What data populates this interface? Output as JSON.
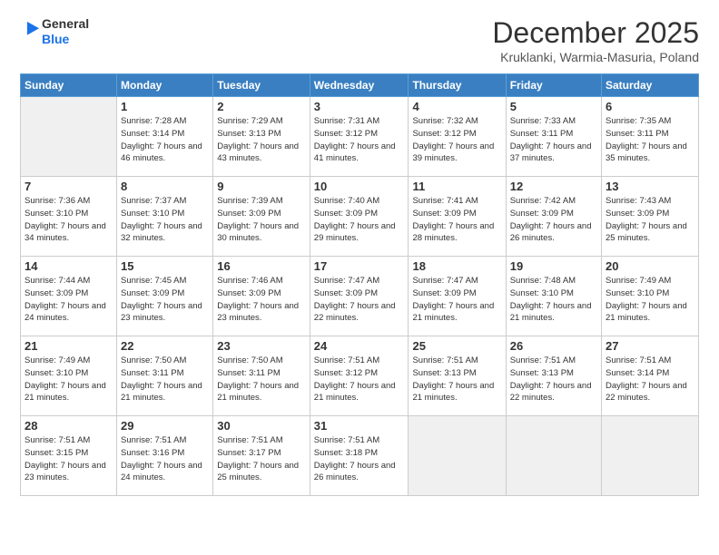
{
  "logo": {
    "line1": "General",
    "line2": "Blue"
  },
  "header": {
    "month": "December 2025",
    "location": "Kruklanki, Warmia-Masuria, Poland"
  },
  "weekdays": [
    "Sunday",
    "Monday",
    "Tuesday",
    "Wednesday",
    "Thursday",
    "Friday",
    "Saturday"
  ],
  "weeks": [
    [
      {
        "day": "",
        "empty": true
      },
      {
        "day": "1",
        "sunrise": "7:28 AM",
        "sunset": "3:14 PM",
        "daylight": "7 hours and 46 minutes."
      },
      {
        "day": "2",
        "sunrise": "7:29 AM",
        "sunset": "3:13 PM",
        "daylight": "7 hours and 43 minutes."
      },
      {
        "day": "3",
        "sunrise": "7:31 AM",
        "sunset": "3:12 PM",
        "daylight": "7 hours and 41 minutes."
      },
      {
        "day": "4",
        "sunrise": "7:32 AM",
        "sunset": "3:12 PM",
        "daylight": "7 hours and 39 minutes."
      },
      {
        "day": "5",
        "sunrise": "7:33 AM",
        "sunset": "3:11 PM",
        "daylight": "7 hours and 37 minutes."
      },
      {
        "day": "6",
        "sunrise": "7:35 AM",
        "sunset": "3:11 PM",
        "daylight": "7 hours and 35 minutes."
      }
    ],
    [
      {
        "day": "7",
        "sunrise": "7:36 AM",
        "sunset": "3:10 PM",
        "daylight": "7 hours and 34 minutes."
      },
      {
        "day": "8",
        "sunrise": "7:37 AM",
        "sunset": "3:10 PM",
        "daylight": "7 hours and 32 minutes."
      },
      {
        "day": "9",
        "sunrise": "7:39 AM",
        "sunset": "3:09 PM",
        "daylight": "7 hours and 30 minutes."
      },
      {
        "day": "10",
        "sunrise": "7:40 AM",
        "sunset": "3:09 PM",
        "daylight": "7 hours and 29 minutes."
      },
      {
        "day": "11",
        "sunrise": "7:41 AM",
        "sunset": "3:09 PM",
        "daylight": "7 hours and 28 minutes."
      },
      {
        "day": "12",
        "sunrise": "7:42 AM",
        "sunset": "3:09 PM",
        "daylight": "7 hours and 26 minutes."
      },
      {
        "day": "13",
        "sunrise": "7:43 AM",
        "sunset": "3:09 PM",
        "daylight": "7 hours and 25 minutes."
      }
    ],
    [
      {
        "day": "14",
        "sunrise": "7:44 AM",
        "sunset": "3:09 PM",
        "daylight": "7 hours and 24 minutes."
      },
      {
        "day": "15",
        "sunrise": "7:45 AM",
        "sunset": "3:09 PM",
        "daylight": "7 hours and 23 minutes."
      },
      {
        "day": "16",
        "sunrise": "7:46 AM",
        "sunset": "3:09 PM",
        "daylight": "7 hours and 23 minutes."
      },
      {
        "day": "17",
        "sunrise": "7:47 AM",
        "sunset": "3:09 PM",
        "daylight": "7 hours and 22 minutes."
      },
      {
        "day": "18",
        "sunrise": "7:47 AM",
        "sunset": "3:09 PM",
        "daylight": "7 hours and 21 minutes."
      },
      {
        "day": "19",
        "sunrise": "7:48 AM",
        "sunset": "3:10 PM",
        "daylight": "7 hours and 21 minutes."
      },
      {
        "day": "20",
        "sunrise": "7:49 AM",
        "sunset": "3:10 PM",
        "daylight": "7 hours and 21 minutes."
      }
    ],
    [
      {
        "day": "21",
        "sunrise": "7:49 AM",
        "sunset": "3:10 PM",
        "daylight": "7 hours and 21 minutes."
      },
      {
        "day": "22",
        "sunrise": "7:50 AM",
        "sunset": "3:11 PM",
        "daylight": "7 hours and 21 minutes."
      },
      {
        "day": "23",
        "sunrise": "7:50 AM",
        "sunset": "3:11 PM",
        "daylight": "7 hours and 21 minutes."
      },
      {
        "day": "24",
        "sunrise": "7:51 AM",
        "sunset": "3:12 PM",
        "daylight": "7 hours and 21 minutes."
      },
      {
        "day": "25",
        "sunrise": "7:51 AM",
        "sunset": "3:13 PM",
        "daylight": "7 hours and 21 minutes."
      },
      {
        "day": "26",
        "sunrise": "7:51 AM",
        "sunset": "3:13 PM",
        "daylight": "7 hours and 22 minutes."
      },
      {
        "day": "27",
        "sunrise": "7:51 AM",
        "sunset": "3:14 PM",
        "daylight": "7 hours and 22 minutes."
      }
    ],
    [
      {
        "day": "28",
        "sunrise": "7:51 AM",
        "sunset": "3:15 PM",
        "daylight": "7 hours and 23 minutes."
      },
      {
        "day": "29",
        "sunrise": "7:51 AM",
        "sunset": "3:16 PM",
        "daylight": "7 hours and 24 minutes."
      },
      {
        "day": "30",
        "sunrise": "7:51 AM",
        "sunset": "3:17 PM",
        "daylight": "7 hours and 25 minutes."
      },
      {
        "day": "31",
        "sunrise": "7:51 AM",
        "sunset": "3:18 PM",
        "daylight": "7 hours and 26 minutes."
      },
      {
        "day": "",
        "empty": true
      },
      {
        "day": "",
        "empty": true
      },
      {
        "day": "",
        "empty": true
      }
    ]
  ]
}
